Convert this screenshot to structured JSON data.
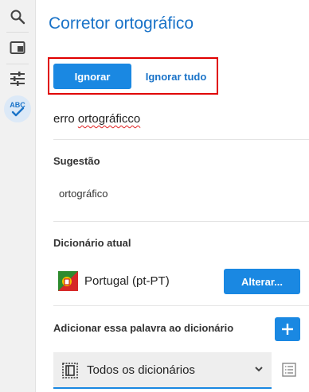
{
  "rail": {
    "items": [
      {
        "icon": "search-icon"
      },
      {
        "icon": "window-icon"
      },
      {
        "icon": "settings-sliders-icon"
      },
      {
        "icon": "spellcheck-icon",
        "text": "ABC"
      }
    ]
  },
  "panel": {
    "title": "Corretor ortográfico",
    "ignore_label": "Ignorar",
    "ignore_all_label": "Ignorar tudo",
    "misspelled": {
      "before": "erro ",
      "word": "ortográficco"
    },
    "suggestion_heading": "Sugestão",
    "suggestion": "ortográfico",
    "current_dictionary_heading": "Dicionário atual",
    "current_dictionary": "Portugal (pt-PT)",
    "change_label": "Alterar...",
    "add_heading": "Adicionar essa palavra ao dicionário",
    "dictionary_select_value": "Todos os dicionários"
  },
  "colors": {
    "accent": "#1a88e2",
    "title": "#1a73c8",
    "highlight": "#e00000"
  }
}
